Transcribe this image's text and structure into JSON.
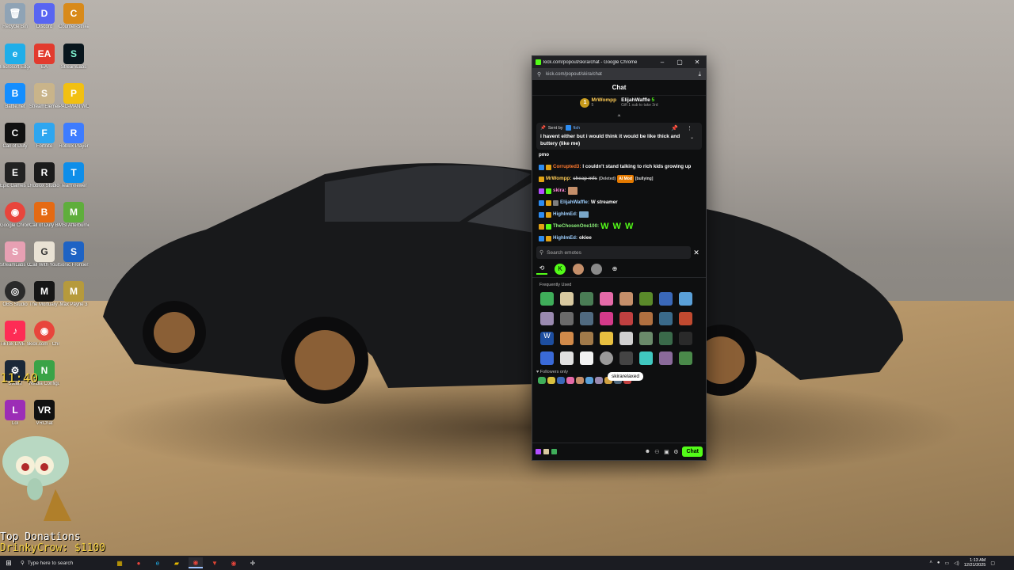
{
  "window": {
    "title": "kick.com/popout/skira/chat - Google Chrome",
    "url": "kick.com/popout/skira/chat"
  },
  "chat": {
    "heading": "Chat",
    "gifters": [
      {
        "rank": "1",
        "name": "MrWompp",
        "count": "5",
        "color": "#ffcc55"
      },
      {
        "name": "ElijahWaffle",
        "count": "5",
        "color": "#ffffff",
        "note": "Gift 1 sub to take 3rd"
      }
    ],
    "pinned": {
      "sent_by": "Sent by",
      "author": "fish",
      "message": "i havent either but i would think it would be like thick and buttery (like me)"
    },
    "messages": [
      {
        "text": "pmo"
      },
      {
        "user": "Corrupted3:",
        "text": "I couldn't stand talking to rich kids growing up"
      },
      {
        "user": "MrWompp:",
        "text": "cheap mfs",
        "deleted": "(Deleted)",
        "mod": "AI Mod",
        "reason": "[bullying]"
      },
      {
        "user": "skira:",
        "text": ""
      },
      {
        "user": "ElijahWaffle:",
        "text": "W streamer"
      },
      {
        "user": "HighImEd:",
        "text": ""
      },
      {
        "user": "TheChosenOne100:",
        "text": "W W W"
      },
      {
        "user": "HighImEd:",
        "text": "okiee"
      }
    ],
    "emote_search_placeholder": "Search emotes",
    "frequently_used": "Frequently Used",
    "tooltip": "skirarelaxed",
    "followers_only": "Followers only",
    "send_label": "Chat"
  },
  "desktop": {
    "icons": [
      "Recycle Bin",
      "Discord",
      "Counter-Strike 2",
      "Microsoft Edge",
      "EA",
      "StreamLabs",
      "Battle.net",
      "StreamElements SE.Live",
      "PAC-MAN WORLD",
      "Call of Duty",
      "Fortnite",
      "Roblox Player",
      "Epic Games Launcher",
      "Roblox Studio",
      "TeamViewer",
      "Google Chrome",
      "Call of Duty Black Ops III",
      "MSI Afterburner",
      "StreamLabs OBS",
      "Call With Your Friends",
      "Sonic Frontiers",
      "OBS Studio",
      "The Mortuary Assistant",
      "Max Payne 3",
      "TikTok LIVE Studio",
      "kick.com - Chrome",
      "",
      "Steam",
      "Nvidia Configurator",
      "",
      "Lol",
      "VRChat",
      ""
    ],
    "overlay_timer": "11:40",
    "donations_title": "Top Donations",
    "donations_value": "DrinkyCrow: $1100"
  },
  "taskbar": {
    "search_placeholder": "Type here to search",
    "time": "1:13 AM",
    "date": "12/21/2025"
  }
}
